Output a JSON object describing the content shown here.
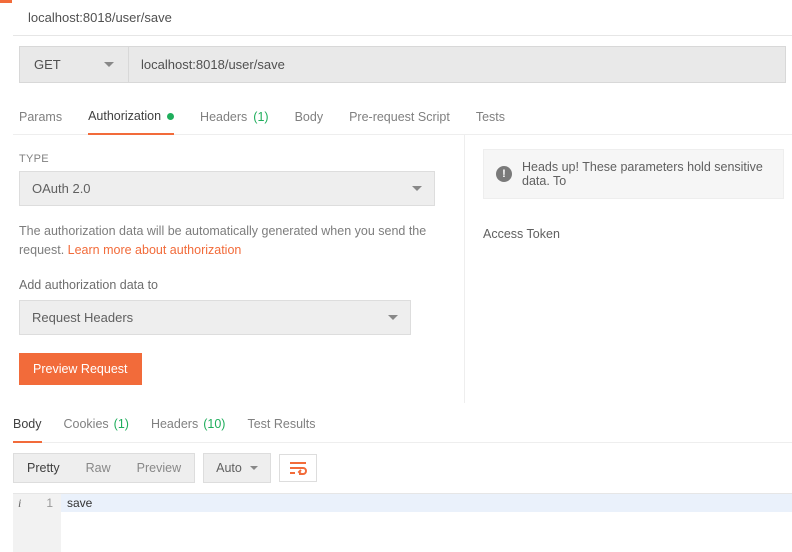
{
  "tabTitle": "localhost:8018/user/save",
  "method": "GET",
  "url": "localhost:8018/user/save",
  "reqTabs": {
    "params": "Params",
    "auth": "Authorization",
    "headers": "Headers",
    "headersCount": "(1)",
    "body": "Body",
    "prerequest": "Pre-request Script",
    "tests": "Tests"
  },
  "auth": {
    "typeLabel": "TYPE",
    "typeValue": "OAuth 2.0",
    "desc1": "The authorization data will be automatically generated when you send the request. ",
    "learnMore": "Learn more about authorization",
    "addToLabel": "Add authorization data to",
    "addToValue": "Request Headers",
    "previewBtn": "Preview Request"
  },
  "rightPane": {
    "notice": "Heads up! These parameters hold sensitive data. To",
    "accessTokenLabel": "Access Token"
  },
  "respTabs": {
    "body": "Body",
    "cookies": "Cookies",
    "cookiesCount": "(1)",
    "headers": "Headers",
    "headersCount": "(10)",
    "testResults": "Test Results"
  },
  "respToolbar": {
    "pretty": "Pretty",
    "raw": "Raw",
    "preview": "Preview",
    "auto": "Auto"
  },
  "responseBody": {
    "lineNo": "1",
    "content": "save"
  }
}
